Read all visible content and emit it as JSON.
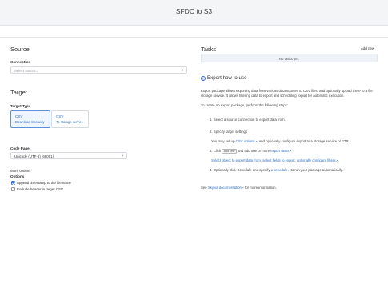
{
  "header": {
    "title": "SFDC to S3"
  },
  "source": {
    "heading": "Source",
    "connection_label": "Connection",
    "connection_placeholder": "Select source..."
  },
  "target": {
    "heading": "Target",
    "type_label": "Target Type",
    "options": [
      {
        "title": "CSV",
        "subtitle": "Download manually",
        "selected": true
      },
      {
        "title": "CSV",
        "subtitle": "To storage service",
        "selected": false
      }
    ],
    "code_page_label": "Code Page",
    "code_page_value": "Unicode (UTF-8) (65001)",
    "more_options": "More options",
    "options_label": "Options",
    "checkboxes": [
      {
        "label": "Append timestamp to the file name",
        "checked": true
      },
      {
        "label": "Exclude header in target CSV",
        "checked": false
      }
    ]
  },
  "tasks": {
    "heading": "Tasks",
    "add_new": "Add new",
    "empty": "No tasks yet."
  },
  "help": {
    "title": "Export how to use",
    "intro": "Export package allows exporting data from various data sources to CSV files, and optionally upload there to a file storage service. It allows filtering data to export and scheduling export for automatic execution.",
    "intro2": "To create an export package, perform the following steps:",
    "step1": "1. Select a source connection to export data from.",
    "step2": "2. Specify target settings",
    "step2_sub_a": "You may set up",
    "step2_sub_link": "CSV options",
    "step2_sub_b": ", and optionally configure export to a storage service or FTP.",
    "step3_a": "3. Click",
    "step3_badge": "Add new",
    "step3_b": "and add one or more",
    "step3_link": "export tasks",
    "step3_sub_a": "Select object to export data from, select fields to export, optionally configure",
    "step3_sub_link": "filters",
    "step3_sub_b": ".",
    "step4_a": "4. Optionally click Schedule and specify",
    "step4_link": "a schedule",
    "step4_b": "to run your package automatically.",
    "footer_a": "See",
    "footer_link": "Skyvia documentation",
    "footer_b": "for more information.",
    "ext_icon": "external-link-icon",
    "info_icon": "info-circle-icon"
  },
  "colors": {
    "accent": "#2f6fc7",
    "header_bg": "#f4f5f7"
  }
}
